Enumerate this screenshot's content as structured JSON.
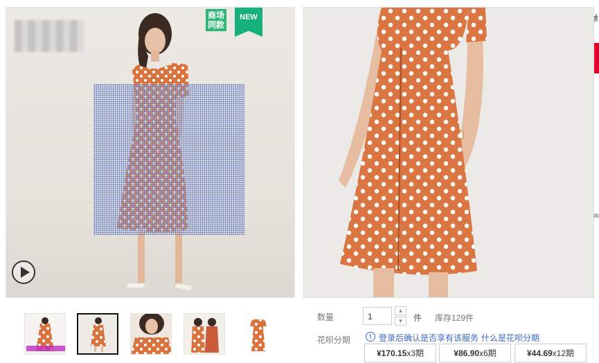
{
  "badges": {
    "mall_line1": "商场",
    "mall_line2": "同款",
    "new": "NEW"
  },
  "purchase": {
    "qty_label": "数量",
    "qty_value": "1",
    "unit": "件",
    "stock": "库存129件",
    "installment_label": "花呗分期",
    "installment_notice": "登录后确认是否享有该服务",
    "installment_link": "什么是花呗分期",
    "plans": [
      {
        "price": "¥170.15",
        "term": "x3期"
      },
      {
        "price": "¥86.90",
        "term": "x6期"
      },
      {
        "price": "¥44.69",
        "term": "x12期"
      }
    ]
  },
  "side": {
    "char_top": "纟",
    "char_mid": "au"
  },
  "thumbnails": [
    {
      "label": "thumb-1",
      "active": false
    },
    {
      "label": "thumb-2",
      "active": true
    },
    {
      "label": "thumb-3",
      "active": false
    },
    {
      "label": "thumb-4",
      "active": false
    },
    {
      "label": "thumb-5",
      "active": false
    }
  ],
  "colors": {
    "dress": "#d9743f",
    "badge_green": "#2bb673",
    "link_blue": "#3c6ac4"
  }
}
